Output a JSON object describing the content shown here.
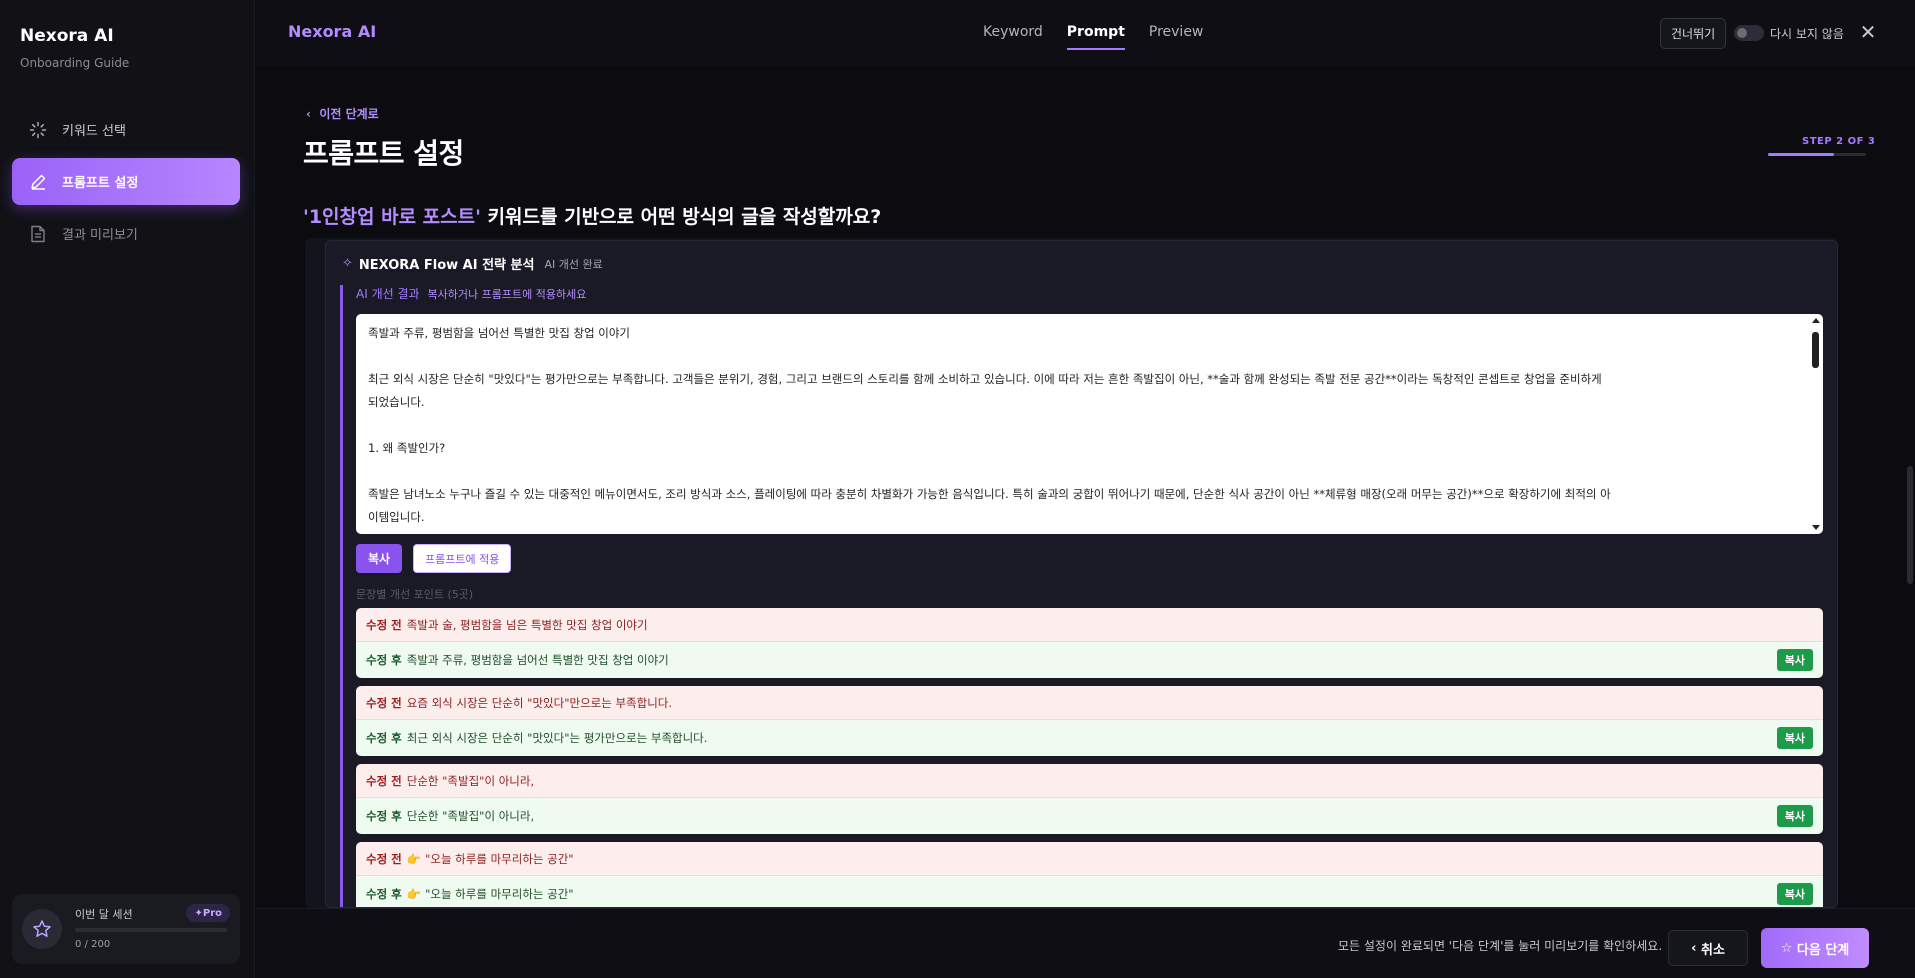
{
  "sidebar": {
    "brand_title": "Nexora AI",
    "brand_subtitle": "Onboarding Guide",
    "items": [
      {
        "label": "키워드 선택",
        "icon": "loader-icon",
        "state": "done"
      },
      {
        "label": "프롬프트 설정",
        "icon": "pencil-icon",
        "state": "active"
      },
      {
        "label": "결과 미리보기",
        "icon": "document-icon",
        "state": "pending"
      }
    ],
    "session": {
      "label": "이번 달 세션",
      "badge": "✦Pro",
      "count": "0 / 200",
      "progress": 0
    }
  },
  "topbar": {
    "brand": "Nexora AI",
    "tabs": [
      {
        "label": "Keyword",
        "active": false
      },
      {
        "label": "Prompt",
        "active": true
      },
      {
        "label": "Preview",
        "active": false
      }
    ],
    "skip_label": "건너뛰기",
    "dont_show_label": "다시 보지 않음",
    "dont_show_enabled": false
  },
  "main": {
    "back_label": "이전 단계로",
    "title": "프롬프트 설정",
    "step_label": "STEP 2 OF 3",
    "step_progress": 0.67,
    "question_keyword": "'1인창업 바로 포스트'",
    "question_rest": " 키워드를 기반으로 어떤 방식의 글을 작성할까요?",
    "panel": {
      "title": "NEXORA Flow AI 전략 분석",
      "status": "AI 개선 완료",
      "result_title": "AI 개선 결과",
      "result_hint": "복사하거나 프롬프트에 적용하세요",
      "result_lines": [
        "족발과 주류, 평범함을 넘어선 특별한 맛집 창업 이야기",
        "",
        "최근 외식 시장은 단순히 \"맛있다\"는 평가만으로는 부족합니다. 고객들은 분위기, 경험, 그리고 브랜드의 스토리를 함께 소비하고 있습니다. 이에 따라 저는 흔한 족발집이 아닌, **술과 함께 완성되는 족발 전문 공간**이라는 독창적인 콘셉트로 창업을 준비하게",
        "되었습니다.",
        "",
        "1. 왜 족발인가?",
        "",
        "족발은 남녀노소 누구나 즐길 수 있는 대중적인 메뉴이면서도, 조리 방식과 소스, 플레이팅에 따라 충분히 차별화가 가능한 음식입니다. 특히 술과의 궁합이 뛰어나기 때문에, 단순한 식사 공간이 아닌 **체류형 매장(오래 머무는 공간)**으로 확장하기에 최적의 아",
        "이템입니다."
      ],
      "copy_label": "복사",
      "apply_label": "프롬프트에 적용",
      "points_label": "문장별 개선 포인트 (5곳)",
      "before_tag": "수정 전",
      "after_tag": "수정 후",
      "mini_copy_label": "복사",
      "diffs": [
        {
          "before": "족발과 술, 평범함을 넘은 특별한 맛집 창업 이야기",
          "after": "족발과 주류, 평범함을 넘어선 특별한 맛집 창업 이야기",
          "emoji": ""
        },
        {
          "before": "요즘 외식 시장은 단순히 \"맛있다\"만으로는 부족합니다.",
          "after": "최근 외식 시장은 단순히 \"맛있다\"는 평가만으로는 부족합니다.",
          "emoji": ""
        },
        {
          "before": "단순한 \"족발집\"이 아니라,",
          "after": "단순한 \"족발집\"이 아니라,",
          "emoji": ""
        },
        {
          "before": "\"오늘 하루를 마무리하는 공간\"",
          "after": "\"오늘 하루를 마무리하는 공간\"",
          "emoji": "👉"
        }
      ]
    }
  },
  "footer": {
    "message": "모든 설정이 완료되면 '다음 단계'를 눌러 미리보기를 확인하세요.",
    "cancel_label": "취소",
    "next_label": "다음 단계"
  },
  "colors": {
    "accent": "#a47bff",
    "accent_strong": "#8a52ee",
    "before_bg": "#fdeeee",
    "after_bg": "#effaf1",
    "copy_green": "#1e9a4b"
  }
}
